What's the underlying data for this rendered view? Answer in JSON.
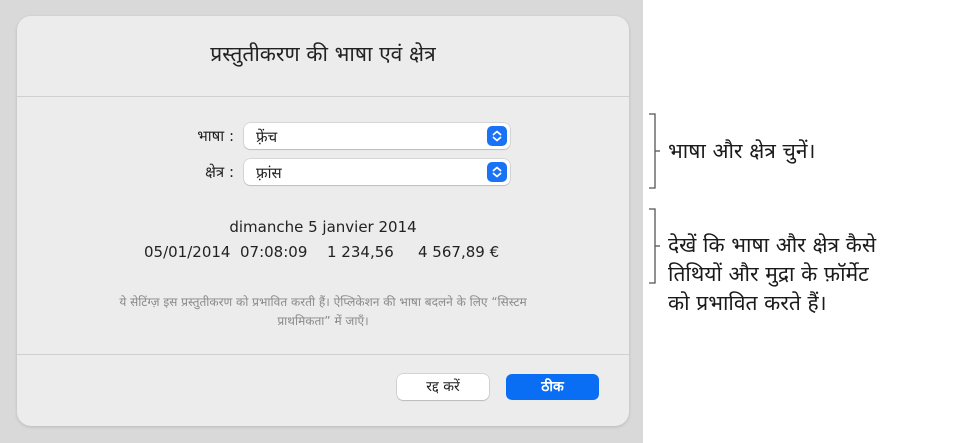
{
  "dialog": {
    "title": "प्रस्तुतीकरण की भाषा एवं क्षेत्र",
    "language": {
      "label": "भाषा :",
      "value": "फ़्रेंच"
    },
    "region": {
      "label": "क्षेत्र :",
      "value": "फ़्रांस"
    },
    "preview": {
      "date_long": "dimanche 5 janvier 2014",
      "date_short": "05/01/2014",
      "time": "07:08:09",
      "number": "1 234,56",
      "currency": "4 567,89 €"
    },
    "hint": {
      "line1": "ये सेटिंग्ज़ इस प्रस्तुतीकरण को प्रभावित करती हैं। ऐप्लिकेशन की भाषा बदलने के लिए “सिस्टम",
      "line2": "प्राथमिकता” में जाएँ।"
    },
    "buttons": {
      "cancel": "रद्द करें",
      "ok": "ठीक"
    }
  },
  "callouts": {
    "language_region": "भाषा और क्षेत्र चुनें।",
    "preview_lines": [
      "देखें कि भाषा और क्षेत्र कैसे",
      "तिथियों और मुद्रा के फ़ॉर्मेट",
      "को प्रभावित करते हैं।"
    ]
  },
  "colors": {
    "accent": "#0a6ef5",
    "dialog_background": "#ececec",
    "backdrop": "#d9d9d9"
  },
  "icons": {
    "popup_stepper": "chevron-up-down-icon"
  }
}
